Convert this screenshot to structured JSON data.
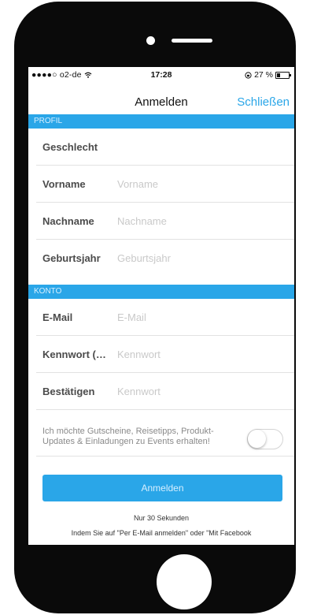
{
  "status_bar": {
    "carrier": "●●●●○ o2-de",
    "time": "17:28",
    "battery": "27 %",
    "battery_level": 0.27
  },
  "nav": {
    "title": "Anmelden",
    "close": "Schließen"
  },
  "sections": {
    "profile": "PROFIL",
    "account": "KONTO"
  },
  "profile_fields": {
    "gender": {
      "label": "Geschlecht"
    },
    "first_name": {
      "label": "Vorname",
      "placeholder": "Vorname"
    },
    "last_name": {
      "label": "Nachname",
      "placeholder": "Nachname"
    },
    "birth_year": {
      "label": "Geburtsjahr",
      "placeholder": "Geburtsjahr"
    }
  },
  "account_fields": {
    "email": {
      "label": "E-Mail",
      "placeholder": "E-Mail"
    },
    "password": {
      "label": "Kennwort (…",
      "placeholder": "Kennwort"
    },
    "confirm": {
      "label": "Bestätigen",
      "placeholder": "Kennwort"
    }
  },
  "consent": {
    "text": "Ich möchte Gutscheine, Reisetipps, Produkt-Updates & Einladungen zu Events erhalten!",
    "enabled": false
  },
  "submit": {
    "label": "Anmelden"
  },
  "footer": {
    "duration": "Nur 30 Sekunden",
    "legal": "Indem Sie auf \"Per E-Mail anmelden\" oder \"Mit Facebook"
  },
  "colors": {
    "accent": "#2aa6e8",
    "label": "#4b4b4b",
    "placeholder": "#c9c9c9"
  }
}
